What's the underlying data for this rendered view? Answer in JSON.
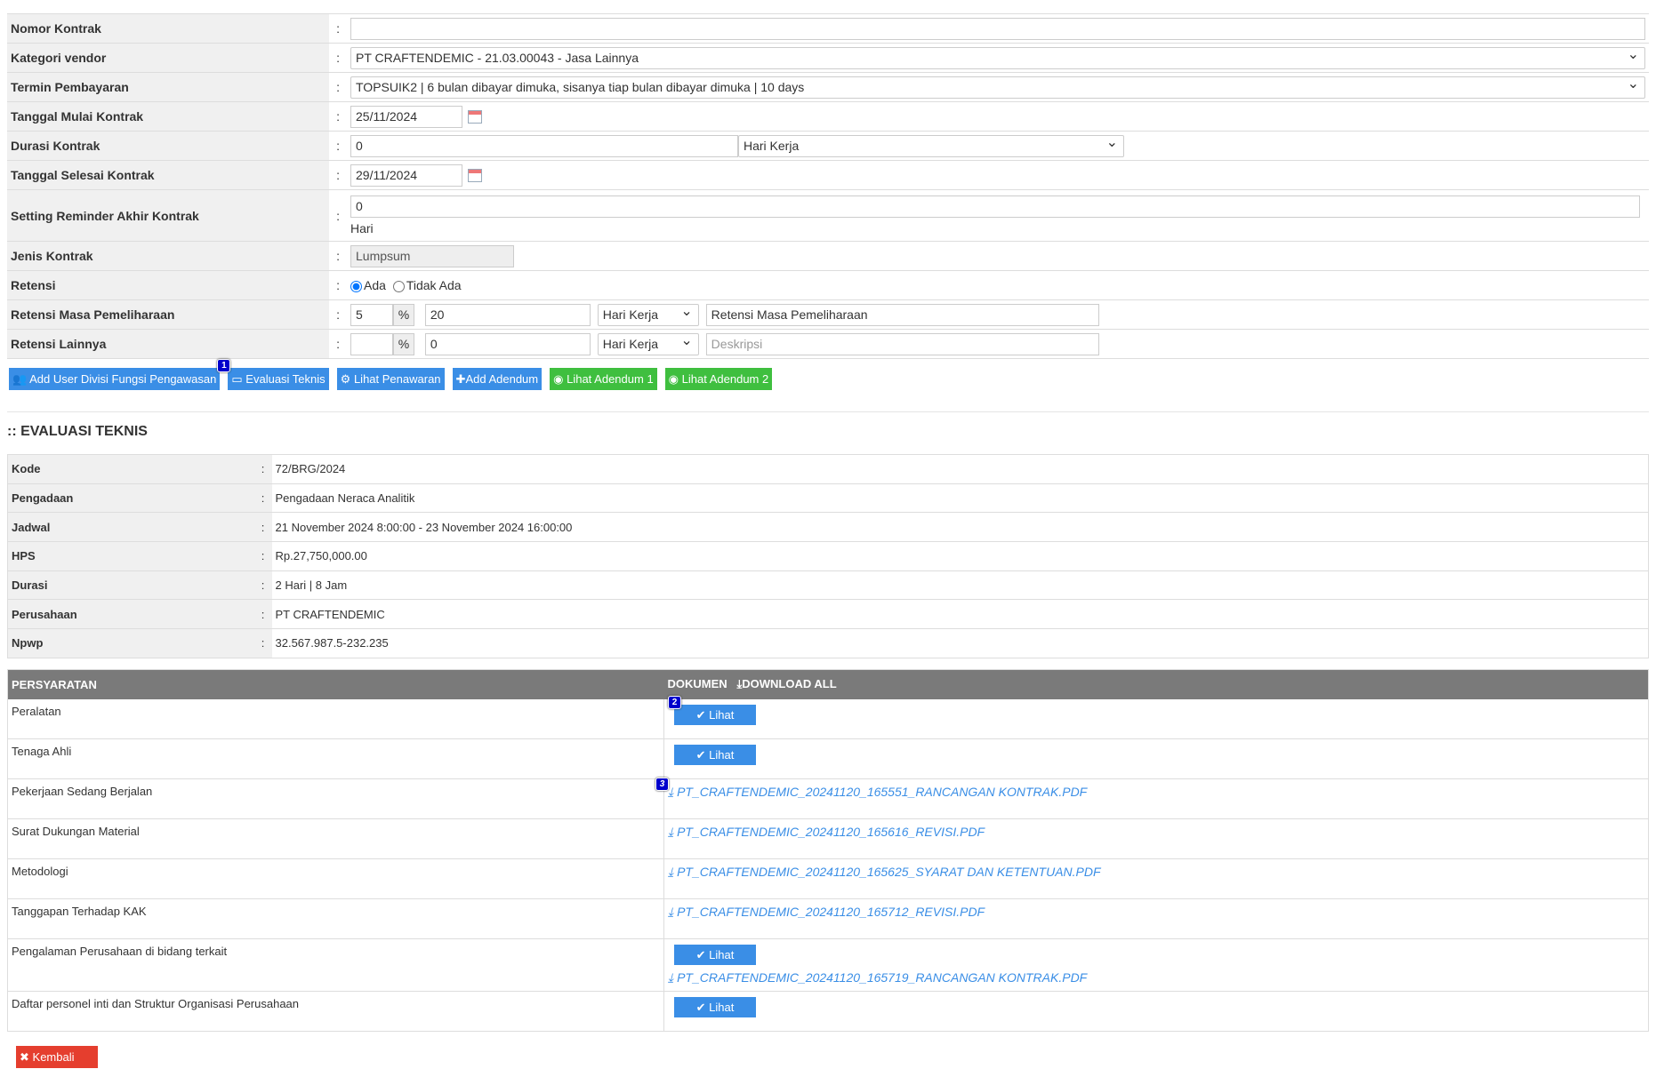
{
  "form": {
    "nomor_kontrak": {
      "label": "Nomor Kontrak",
      "value": ""
    },
    "kategori_vendor": {
      "label": "Kategori vendor",
      "value": "PT CRAFTENDEMIC - 21.03.00043 - Jasa Lainnya"
    },
    "termin": {
      "label": "Termin Pembayaran",
      "value": "TOPSUIK2 | 6 bulan dibayar dimuka, sisanya tiap bulan dibayar dimuka | 10 days"
    },
    "tgl_mulai": {
      "label": "Tanggal Mulai Kontrak",
      "value": "25/11/2024"
    },
    "durasi": {
      "label": "Durasi Kontrak",
      "value": "0",
      "unit": "Hari Kerja"
    },
    "tgl_selesai": {
      "label": "Tanggal Selesai Kontrak",
      "value": "29/11/2024"
    },
    "reminder": {
      "label": "Setting Reminder Akhir Kontrak",
      "value": "0",
      "unit": "Hari"
    },
    "jenis": {
      "label": "Jenis Kontrak",
      "value": "Lumpsum"
    },
    "retensi": {
      "label": "Retensi",
      "opt_ada": "Ada",
      "opt_tidak": "Tidak Ada"
    },
    "retensi_pemeliharaan": {
      "label": "Retensi Masa Pemeliharaan",
      "percent": "5",
      "pct_sign": "%",
      "days": "20",
      "unit": "Hari Kerja",
      "desc": "Retensi Masa Pemeliharaan"
    },
    "retensi_lainnya": {
      "label": "Retensi Lainnya",
      "percent": "",
      "pct_sign": "%",
      "days": "0",
      "unit": "Hari Kerja",
      "desc_placeholder": "Deskripsi"
    },
    "colon": ":"
  },
  "buttons": {
    "add_user": "Add User Divisi Fungsi Pengawasan",
    "evaluasi": "Evaluasi Teknis",
    "lihat_penawaran": "Lihat Penawaran",
    "add_adendum": "Add Adendum",
    "adendum1": "Lihat Adendum 1",
    "adendum2": "Lihat Adendum 2",
    "badge1": "1"
  },
  "section_title": ":: EVALUASI TEKNIS",
  "info": [
    {
      "label": "Kode",
      "value": "72/BRG/2024"
    },
    {
      "label": "Pengadaan",
      "value": "Pengadaan Neraca Analitik"
    },
    {
      "label": "Jadwal",
      "value": "21 November 2024 8:00:00 - 23 November 2024 16:00:00"
    },
    {
      "label": "HPS",
      "value": "Rp.27,750,000.00"
    },
    {
      "label": "Durasi",
      "value": "2 Hari | 8 Jam"
    },
    {
      "label": "Perusahaan",
      "value": "PT CRAFTENDEMIC"
    },
    {
      "label": "Npwp",
      "value": "32.567.987.5-232.235"
    }
  ],
  "req": {
    "h1": "PERSYARATAN",
    "h2": "DOKUMEN",
    "download_all": "DOWNLOAD ALL",
    "lihat": "Lihat",
    "badge2": "2",
    "badge3": "3",
    "rows": [
      {
        "name": "Peralatan"
      },
      {
        "name": "Tenaga Ahli"
      },
      {
        "name": "Pekerjaan Sedang Berjalan",
        "file": "PT_CRAFTENDEMIC_20241120_165551_RANCANGAN KONTRAK.PDF"
      },
      {
        "name": "Surat Dukungan Material",
        "file": "PT_CRAFTENDEMIC_20241120_165616_REVISI.PDF"
      },
      {
        "name": "Metodologi",
        "file": "PT_CRAFTENDEMIC_20241120_165625_SYARAT DAN KETENTUAN.PDF"
      },
      {
        "name": "Tanggapan Terhadap KAK",
        "file": "PT_CRAFTENDEMIC_20241120_165712_REVISI.PDF"
      },
      {
        "name": "Pengalaman Perusahaan di bidang terkait",
        "file": "PT_CRAFTENDEMIC_20241120_165719_RANCANGAN KONTRAK.PDF"
      },
      {
        "name": "Daftar personel inti dan Struktur Organisasi Perusahaan"
      }
    ]
  },
  "kembali": "Kembali"
}
